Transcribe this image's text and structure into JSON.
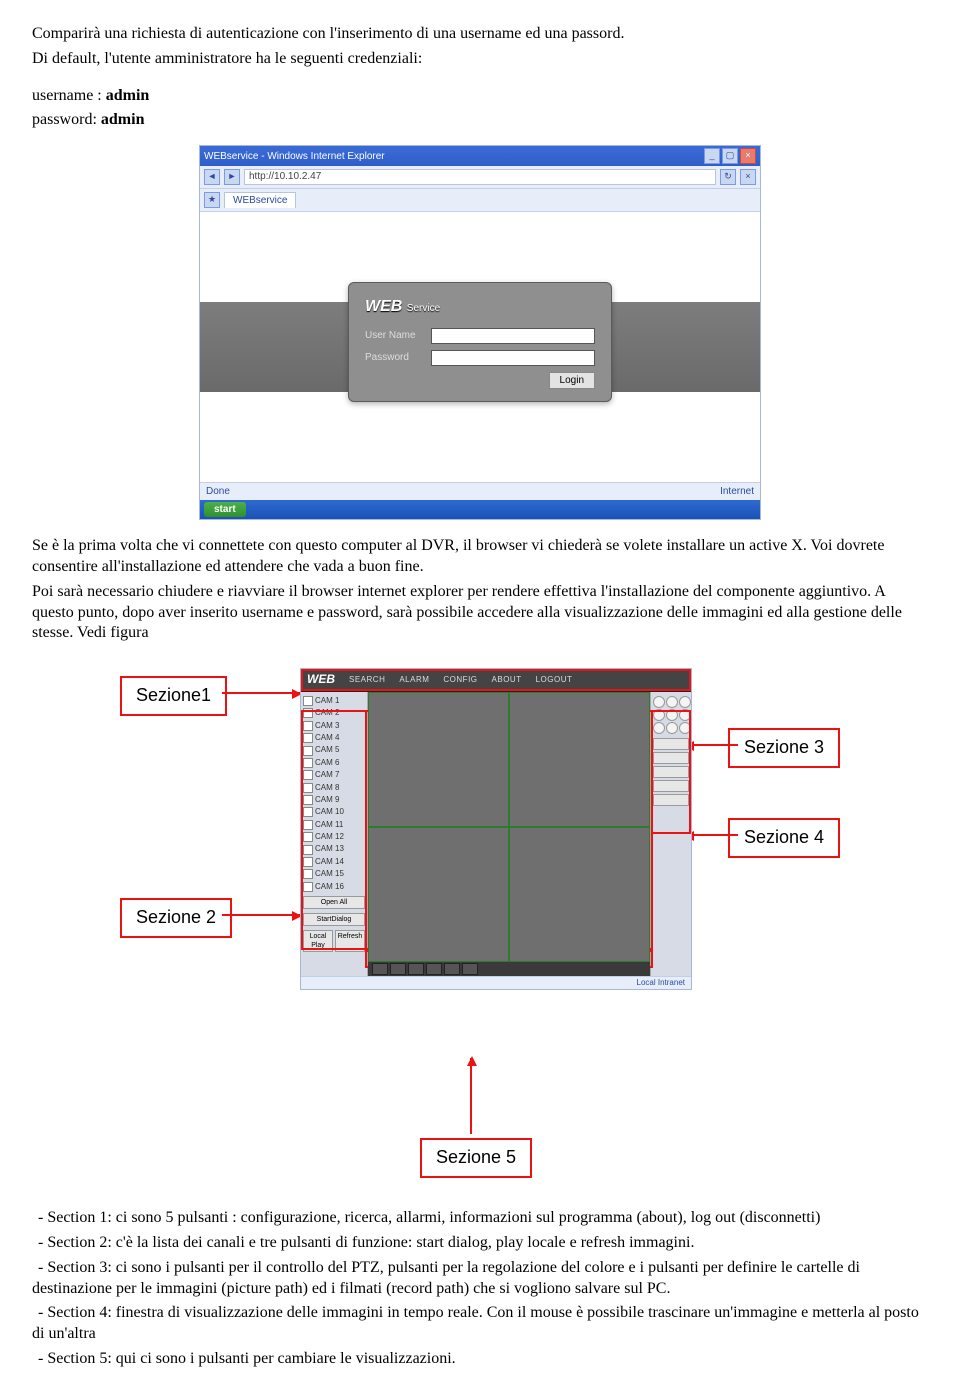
{
  "text": {
    "p1": "Comparirà una richiesta di autenticazione con l'inserimento di una username ed una passord.",
    "p2": "Di default, l'utente amministratore ha le seguenti credenziali:",
    "user_label": "username : ",
    "user_value": "admin",
    "pass_label": "password: ",
    "pass_value": "admin",
    "p3a": "Se è la prima volta che vi connettete con questo computer al DVR, il browser vi chiederà se volete installare un active X. Voi dovrete consentire all'installazione ed attendere che vada a buon fine.",
    "p3b": "Poi sarà necessario chiudere e riavviare il browser internet explorer per rendere effettiva l'installazione del componente aggiuntivo. A questo punto, dopo aver inserito username e password, sarà possibile accedere alla visualizzazione delle immagini ed alla gestione delle stesse. Vedi figura"
  },
  "ie_shot": {
    "title": "WEBservice - Windows Internet Explorer",
    "address": "http://10.10.2.47",
    "tab": "WEBservice",
    "status_left": "Done",
    "status_right": "Internet",
    "start": "start"
  },
  "login": {
    "brand": "WEB",
    "brand_small": "Service",
    "user_label": "User Name",
    "pass_label": "Password",
    "submit": "Login"
  },
  "anno": {
    "s1": "Sezione1",
    "s2": "Sezione 2",
    "s3": "Sezione 3",
    "s4": "Sezione 4",
    "s5": "Sezione 5"
  },
  "webnav": {
    "logo": "WEB",
    "items": [
      "SEARCH",
      "ALARM",
      "CONFIG",
      "ABOUT",
      "LOGOUT"
    ]
  },
  "channels": {
    "prefix": "CAM ",
    "count": 16,
    "open_all": "Open All",
    "dialog": "StartDialog",
    "local": "Local Play",
    "refresh": "Refresh"
  },
  "sections": {
    "s1": " - Section 1: ci sono 5 pulsanti : configurazione, ricerca, allarmi, informazioni sul programma (about), log out (disconnetti)",
    "s2": " - Section 2: c'è la lista dei canali e tre pulsanti di funzione: start dialog, play locale e refresh immagini.",
    "s3": " - Section 3: ci sono i pulsanti per il controllo del PTZ, pulsanti per la regolazione del colore e i pulsanti per definire le cartelle di destinazione per le immagini (picture path) ed i filmati (record path) che si vogliono salvare sul PC.",
    "s4": " - Section 4: finestra di visualizzazione delle immagini in tempo reale. Con il mouse è possibile trascinare un'immagine e metterla al posto di un'altra",
    "s5": " - Section 5: qui ci sono i pulsanti per cambiare le visualizzazioni."
  }
}
